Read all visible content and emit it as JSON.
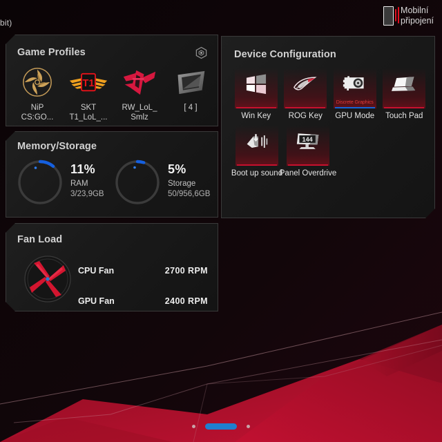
{
  "desktop": {
    "title_fragment": "bit)",
    "mobile_connection": {
      "line1": "Mobilní",
      "line2": "připojení",
      "icon": "phone-signal-icon"
    }
  },
  "panels": {
    "game_profiles": {
      "title": "Game Profiles",
      "settings_icon": "hex-gear-icon",
      "items": [
        {
          "icon": "nip-ninja-star-icon",
          "line1": "NiP",
          "line2": "CS:GO..."
        },
        {
          "icon": "skt-t1-wings-icon",
          "line1": "SKT",
          "line2": "T1_LoL_..."
        },
        {
          "icon": "rw-lol-arrow-icon",
          "line1": "RW_LoL_",
          "line2": "Smlz"
        },
        {
          "icon": "empty-slot-icon",
          "line1": "[ 4 ]",
          "line2": ""
        }
      ]
    },
    "memory_storage": {
      "title": "Memory/Storage",
      "gauges": [
        {
          "percent": "11%",
          "value": 11,
          "label": "RAM",
          "detail": "3/23,9GB",
          "color": "#1560e0"
        },
        {
          "percent": "5%",
          "value": 5,
          "label": "Storage",
          "detail": "50/956,6GB",
          "color": "#1560e0"
        }
      ]
    },
    "fan_load": {
      "title": "Fan Load",
      "icon": "fan-blades-icon",
      "rows": [
        {
          "name": "CPU Fan",
          "value": "2700  RPM"
        },
        {
          "name": "GPU Fan",
          "value": "2400  RPM"
        }
      ]
    },
    "device_configuration": {
      "title": "Device Configuration",
      "items": [
        {
          "icon": "windows-logo-icon",
          "label": "Win Key",
          "state": "",
          "active": false
        },
        {
          "icon": "rog-eye-icon",
          "label": "ROG Key",
          "state": "",
          "active": false
        },
        {
          "icon": "graphics-card-icon",
          "label": "GPU Mode",
          "state": "Discrete Graphics",
          "active": true
        },
        {
          "icon": "laptop-touchpad-icon",
          "label": "Touch Pad",
          "state": "",
          "active": false
        },
        {
          "icon": "boot-sound-icon",
          "label": "Boot up sound",
          "state": "",
          "active": false
        },
        {
          "icon": "monitor-144hz-icon",
          "label": "Panel Overdrive",
          "state": "",
          "active": false
        }
      ]
    }
  },
  "taskbar": {
    "pill_indicator": "active-window-pill",
    "dots": 2
  },
  "theme": {
    "accent_red": "#c8102e",
    "accent_blue": "#1565d8",
    "panel_bg": "#191919",
    "panel_border": "#3a3a3a"
  }
}
